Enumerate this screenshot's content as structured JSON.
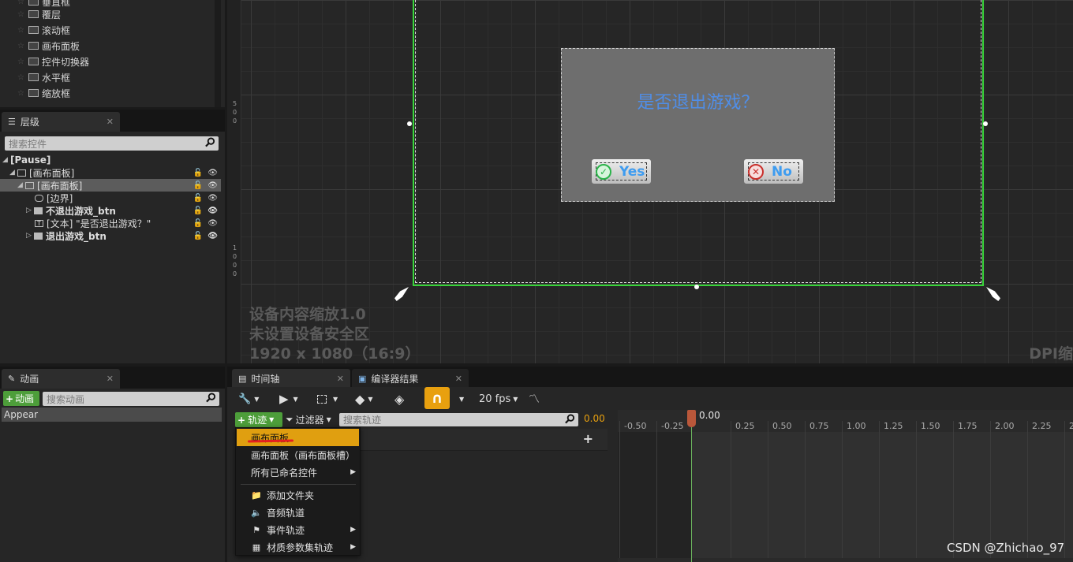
{
  "palette": {
    "items": [
      {
        "label": "垂直框",
        "icon": "vertical-box-icon"
      },
      {
        "label": "覆层",
        "icon": "overlay-icon"
      },
      {
        "label": "滚动框",
        "icon": "scroll-box-icon"
      },
      {
        "label": "画布面板",
        "icon": "canvas-panel-icon"
      },
      {
        "label": "控件切换器",
        "icon": "widget-switcher-icon"
      },
      {
        "label": "水平框",
        "icon": "horizontal-box-icon"
      },
      {
        "label": "缩放框",
        "icon": "scale-box-icon"
      }
    ]
  },
  "hierarchy": {
    "tab_label": "层级",
    "search_placeholder": "搜索控件",
    "rows": [
      {
        "label": "[Pause]"
      },
      {
        "label": "[画布面板]"
      },
      {
        "label": "[画布面板]"
      },
      {
        "label": "[边界]"
      },
      {
        "label": "不退出游戏_btn"
      },
      {
        "label": "[文本] \"是否退出游戏？\""
      },
      {
        "label": "退出游戏_btn"
      }
    ]
  },
  "canvas": {
    "ruler_left_top": [
      "5",
      "0",
      "0"
    ],
    "ruler_left_bottom": [
      "1",
      "0",
      "0",
      "0"
    ],
    "dialog_title": "是否退出游戏？",
    "yes_label": "Yes",
    "no_label": "No",
    "overlay_lines": [
      "设备内容缩放1.0",
      "未设置设备安全区",
      "1920 x 1080（16:9）"
    ],
    "dpi_label": "DPI缩"
  },
  "animation": {
    "tab_label": "动画",
    "add_label": "动画",
    "search_placeholder": "搜索动画",
    "items": [
      "Appear"
    ]
  },
  "timeline": {
    "tabs": [
      "时间轴",
      "编译器结果"
    ],
    "fps_label": "20 fps",
    "track_label": "轨迹",
    "filter_label": "过滤器",
    "search_placeholder": "搜索轨迹",
    "current_time": "0.00",
    "playhead_time": "0.00",
    "ticks": [
      "-0.50",
      "-0.25",
      "0.25",
      "0.50",
      "0.75",
      "1.00",
      "1.25",
      "1.50",
      "1.75",
      "2.00",
      "2.25",
      "2"
    ],
    "menu": {
      "items": [
        {
          "label": "画布面板",
          "highlighted": true
        },
        {
          "label": "画布面板（画布面板槽）"
        },
        {
          "label": "所有已命名控件",
          "submenu": true
        },
        {
          "label": "添加文件夹",
          "icon": "folder-icon"
        },
        {
          "label": "音频轨道",
          "icon": "speaker-icon"
        },
        {
          "label": "事件轨迹",
          "icon": "flag-icon",
          "submenu": true
        },
        {
          "label": "材质参数集轨迹",
          "icon": "material-icon",
          "submenu": true
        }
      ]
    }
  },
  "watermark": "CSDN @Zhichao_97",
  "colors": {
    "accent": "#e09f10",
    "add_green": "#4d9e3a",
    "frame_green": "#39d43a",
    "dialog_title": "#4f8ee8",
    "playhead": "#b9573a"
  }
}
